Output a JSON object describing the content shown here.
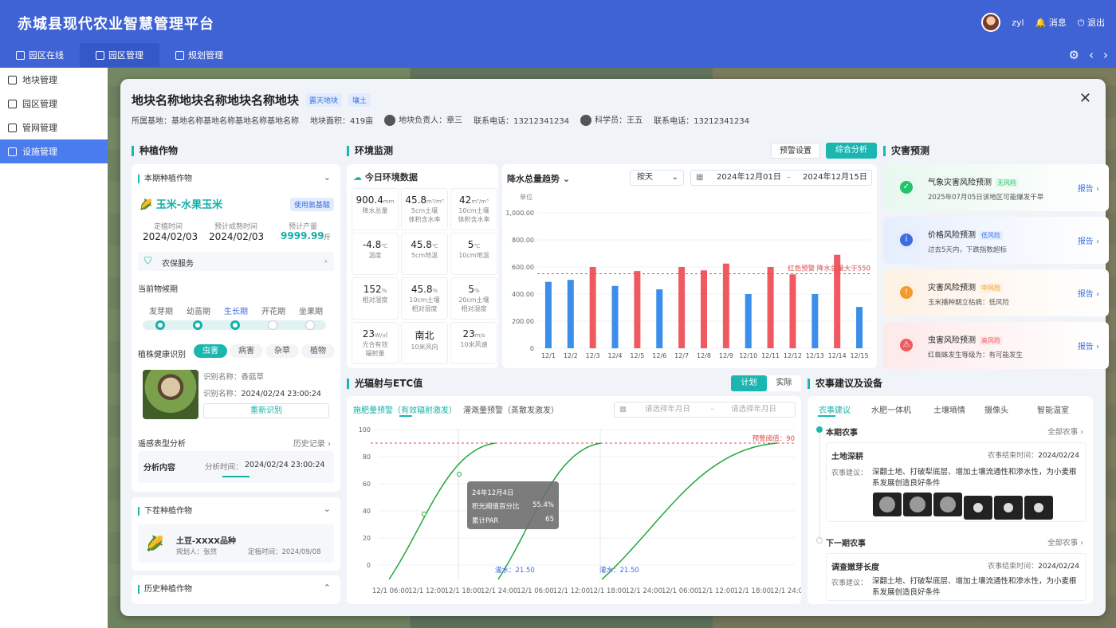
{
  "app": {
    "title": "赤城县现代农业智慧管理平台",
    "user": "zyl",
    "msg": "消息",
    "logout": "退出"
  },
  "topnav": [
    "园区在线",
    "园区管理",
    "规划管理"
  ],
  "sidebar": [
    "地块管理",
    "园区管理",
    "管网管理",
    "设施管理"
  ],
  "plot": {
    "name": "地块名称地块名称地块名称地块",
    "tag1": "露天地块",
    "tag2": "壤土",
    "base": "所属基地：基地名称基地名称基地名称基地名称",
    "area": "地块面积：419亩",
    "owner": "地块负责人：章三",
    "phone1": "联系电话：13212341234",
    "sci": "科学员：王五",
    "phone2": "联系电话：13212341234"
  },
  "crops": {
    "header": "种植作物",
    "current": "本期种植作物",
    "name": "玉米-水果玉米",
    "tech": "使用氨基酸",
    "plant_l": "定植时间",
    "plant_v": "2024/02/03",
    "ripe_l": "预计成熟时间",
    "ripe_v": "2024/02/03",
    "yield_l": "预计产量",
    "yield_v": "9999.99",
    "yield_u": "斤",
    "service": "农保服务",
    "phen": "当前物候期",
    "stages": [
      "发芽期",
      "幼苗期",
      "生长期",
      "开花期",
      "坐果期"
    ],
    "health": "植株健康识别",
    "htabs": [
      "虫害",
      "病害",
      "杂草",
      "植物"
    ],
    "id1": "识别名称：香菇草",
    "id2": "识别名称：",
    "id2v": "2024/02/24 23:00:24",
    "reid": "重新识别",
    "remote": "遥感表型分析",
    "history": "历史记录",
    "analysis": "分析内容",
    "atime": "分析时间：",
    "atimev": "2024/02/24 23:00:24",
    "next": "下茬种植作物",
    "nextName": "土豆-XXXX品种",
    "planner": "规划人：张然",
    "ntime": "定植时间：2024/09/08",
    "hist": "历史种植作物"
  },
  "env": {
    "header": "环境监测",
    "btn1": "预警设置",
    "btn2": "综合分析",
    "today": "今日环境数据",
    "cells": [
      [
        "900.4",
        "mm",
        "降水总量"
      ],
      [
        "45.8",
        "m³/m³",
        "5cm土壤\n体积含水率"
      ],
      [
        "42",
        "m³/m³",
        "10cm土壤\n体积含水率"
      ],
      [
        "-4.8",
        "℃",
        "温度"
      ],
      [
        "45.8",
        "℃",
        "5cm地温"
      ],
      [
        "5",
        "℃",
        "10cm地温"
      ],
      [
        "152",
        "%",
        "相对湿度"
      ],
      [
        "45.8",
        "%",
        "10cm土壤\n相对湿度"
      ],
      [
        "5",
        "%",
        "20cm土壤\n相对湿度"
      ],
      [
        "23",
        "W/㎡",
        "光合有效\n辐射量"
      ],
      [
        "南北",
        "",
        "10米风向"
      ],
      [
        "23",
        "m/s",
        "10米风速"
      ]
    ],
    "trend": "降水总量趋势",
    "period": "按天",
    "d1": "2024年12月01日",
    "d2": "2024年12月15日",
    "unit": "单位"
  },
  "chart_data": [
    {
      "type": "bar",
      "title": "降水总量趋势",
      "ylabel": "单位",
      "ylim": [
        0,
        1000
      ],
      "yticks": [
        "0",
        "200.00",
        "400.00",
        "600.00",
        "800.00",
        "1,000.00"
      ],
      "categories": [
        "12/1",
        "12/2",
        "12/3",
        "12/4",
        "12/5",
        "12/6",
        "12/7",
        "12/8",
        "12/9",
        "12/10",
        "12/11",
        "12/12",
        "12/13",
        "12/14",
        "12/15"
      ],
      "values": [
        490,
        505,
        600,
        460,
        570,
        435,
        600,
        575,
        625,
        400,
        600,
        545,
        400,
        690,
        305
      ],
      "colors": [
        "#3b8eea",
        "#3b8eea",
        "#f0595f",
        "#3b8eea",
        "#f0595f",
        "#3b8eea",
        "#f0595f",
        "#f0595f",
        "#f0595f",
        "#3b8eea",
        "#f0595f",
        "#f0595f",
        "#3b8eea",
        "#f0595f",
        "#3b8eea"
      ],
      "threshold": 550,
      "thresholdLabel": "红色预警 降水总量大于550"
    },
    {
      "type": "line",
      "title": "光辐射与ETC值",
      "ylim": [
        0,
        100
      ],
      "yticks": [
        "0",
        "20",
        "40",
        "60",
        "80",
        "100"
      ],
      "x": [
        "12/1 06:00",
        "12/1 12:00",
        "12/1 18:00",
        "12/1 24:00",
        "12/1 06:00",
        "12/1 12:00",
        "12/1 18:00",
        "12/1 24:00",
        "12/1 06:00",
        "12/1 12:00",
        "12/1 18:00",
        "12/1 24:00"
      ],
      "threshold": 90,
      "thresholdLabel": "预警阈值：90",
      "markLabel": "灌水：21.50"
    }
  ],
  "rad": {
    "header": "光辐射与ETC值",
    "t1": "计划",
    "t2": "实际",
    "tab1": "施肥量预警（有效辐射激发）",
    "tab2": "灌溉量预警（蒸散发激发）",
    "ph1": "请选择年月日",
    "ph2": "请选择年月日",
    "tipDate": "24年12月4日",
    "tipL1": "积光阈值百分比",
    "tipV1": "55.4%",
    "tipL2": "累计PAR",
    "tipV2": "65"
  },
  "disaster": {
    "header": "灾害预测",
    "items": [
      {
        "t": "气象灾害风险预测",
        "b": "无风险",
        "d": "2025年07月05日该地区可能爆发干旱",
        "c": "#21c36b",
        "bg": "#e8f8ef"
      },
      {
        "t": "价格风险预测",
        "b": "低风险",
        "d": "过去5天内，下跌指数超标",
        "c": "#3b6fe0",
        "bg": "#e6eefd"
      },
      {
        "t": "灾害风险预测",
        "b": "中风险",
        "d": "玉米播种期立枯病：低风险",
        "c": "#f29a2e",
        "bg": "#fdf1e4"
      },
      {
        "t": "虫害风险预测",
        "b": "高风险",
        "d": "红蜘蛛发生等级为：有可能发生",
        "c": "#f0595f",
        "bg": "#fde9ea"
      }
    ],
    "report": "报告"
  },
  "farm": {
    "header": "农事建议及设备",
    "tabs": [
      "农事建议",
      "水肥一体机",
      "土壤墒情",
      "摄像头",
      "智能温室"
    ],
    "cur": "本期农事",
    "all": "全部农事",
    "t1": "土地深耕",
    "end1": "农事结束时间：",
    "end1v": "2024/02/24",
    "advL": "农事建议：",
    "adv": "深翻土地、打破犁底层、增加土壤流通性和渗水性，为小麦根系发展创造良好条件",
    "next": "下一期农事",
    "t2": "调查嫩芽长度",
    "end2": "农事结束时间：",
    "end2v": "2024/02/24"
  }
}
